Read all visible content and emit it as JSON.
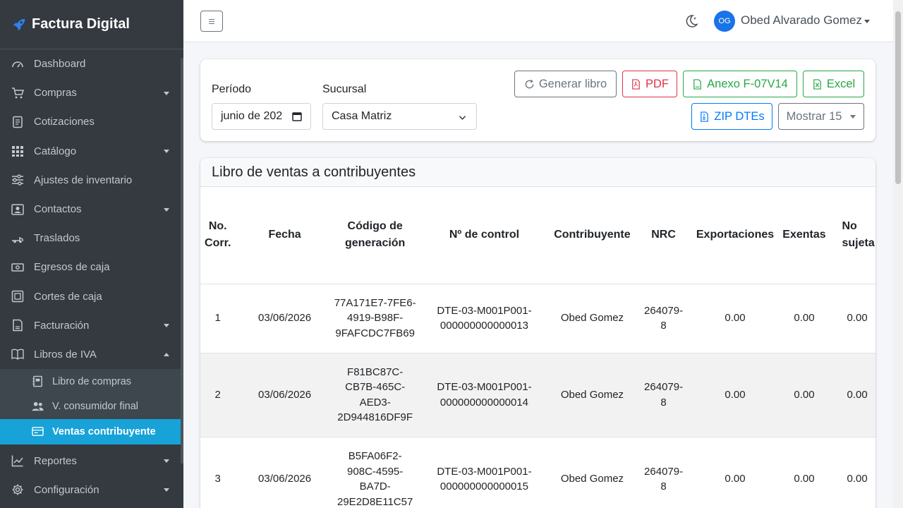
{
  "brand": {
    "name": "Factura Digital",
    "icon": "rocket-icon"
  },
  "sidebar": {
    "items": [
      {
        "label": "Dashboard",
        "icon": "dashboard-icon",
        "caret": false
      },
      {
        "label": "Compras",
        "icon": "cart-icon",
        "caret": true
      },
      {
        "label": "Cotizaciones",
        "icon": "document-icon",
        "caret": false
      },
      {
        "label": "Catálogo",
        "icon": "grid-icon",
        "caret": true
      },
      {
        "label": "Ajustes de inventario",
        "icon": "sliders-icon",
        "caret": false
      },
      {
        "label": "Contactos",
        "icon": "contact-icon",
        "caret": true
      },
      {
        "label": "Traslados",
        "icon": "truck-icon",
        "caret": false
      },
      {
        "label": "Egresos de caja",
        "icon": "cash-icon",
        "caret": false
      },
      {
        "label": "Cortes de caja",
        "icon": "safe-icon",
        "caret": false
      },
      {
        "label": "Facturación",
        "icon": "invoice-icon",
        "caret": true
      },
      {
        "label": "Libros de IVA",
        "icon": "book-icon",
        "caret": true,
        "expanded": true
      }
    ],
    "subitems": [
      {
        "label": "Libro de compras",
        "icon": "journal-icon",
        "active": false
      },
      {
        "label": "V. consumidor final",
        "icon": "people-icon",
        "active": false
      },
      {
        "label": "Ventas contribuyente",
        "icon": "card-icon",
        "active": true
      }
    ],
    "bottom_items": [
      {
        "label": "Reportes",
        "icon": "chart-icon",
        "caret": true
      },
      {
        "label": "Configuración",
        "icon": "gear-icon",
        "caret": true
      }
    ]
  },
  "topbar": {
    "user_initials": "OG",
    "user_name": "Obed Alvarado Gomez",
    "theme_icon": "moon-icon",
    "menu_icon": "hamburger-icon"
  },
  "filters": {
    "periodo_label": "Período",
    "periodo_value": "junio de 202",
    "sucursal_label": "Sucursal",
    "sucursal_value": "Casa Matriz"
  },
  "actions": {
    "generar": "Generar libro",
    "pdf": "PDF",
    "anexo": "Anexo F-07V14",
    "excel": "Excel",
    "zip": "ZIP DTEs",
    "mostrar": "Mostrar 15"
  },
  "colors": {
    "sidebar_bg": "#343a40",
    "active": "#17a2d8",
    "primary": "#007bff",
    "danger": "#dc3545",
    "success": "#28a745"
  },
  "table": {
    "title": "Libro de ventas a contribuyentes",
    "headers": [
      {
        "l1": "No.",
        "l2": "Corr."
      },
      {
        "l1": "Fecha",
        "l2": ""
      },
      {
        "l1": "Código de",
        "l2": "generación"
      },
      {
        "l1": "Nº de control",
        "l2": ""
      },
      {
        "l1": "Contribuyente",
        "l2": ""
      },
      {
        "l1": "NRC",
        "l2": ""
      },
      {
        "l1": "Exportaciones",
        "l2": ""
      },
      {
        "l1": "Exentas",
        "l2": ""
      },
      {
        "l1": "No",
        "l2": "sujeta"
      }
    ],
    "rows": [
      {
        "no": "1",
        "fecha": "03/06/2026",
        "codigo": [
          "77A171E7-7FE6-",
          "4919-B98F-",
          "9FAFCDC7FB69"
        ],
        "control": [
          "DTE-03-M001P001-",
          "000000000000013"
        ],
        "contribuyente": "Obed Gomez",
        "nrc": [
          "264079-",
          "8"
        ],
        "exportaciones": "0.00",
        "exentas": "0.00",
        "no_sujetas": "0.00"
      },
      {
        "no": "2",
        "fecha": "03/06/2026",
        "codigo": [
          "F81BC87C-",
          "CB7B-465C-",
          "AED3-",
          "2D944816DF9F"
        ],
        "control": [
          "DTE-03-M001P001-",
          "000000000000014"
        ],
        "contribuyente": "Obed Gomez",
        "nrc": [
          "264079-",
          "8"
        ],
        "exportaciones": "0.00",
        "exentas": "0.00",
        "no_sujetas": "0.00"
      },
      {
        "no": "3",
        "fecha": "03/06/2026",
        "codigo": [
          "B5FA06F2-",
          "908C-4595-",
          "BA7D-",
          "29E2D8E11C57"
        ],
        "control": [
          "DTE-03-M001P001-",
          "000000000000015"
        ],
        "contribuyente": "Obed Gomez",
        "nrc": [
          "264079-",
          "8"
        ],
        "exportaciones": "0.00",
        "exentas": "0.00",
        "no_sujetas": "0.00"
      }
    ]
  }
}
